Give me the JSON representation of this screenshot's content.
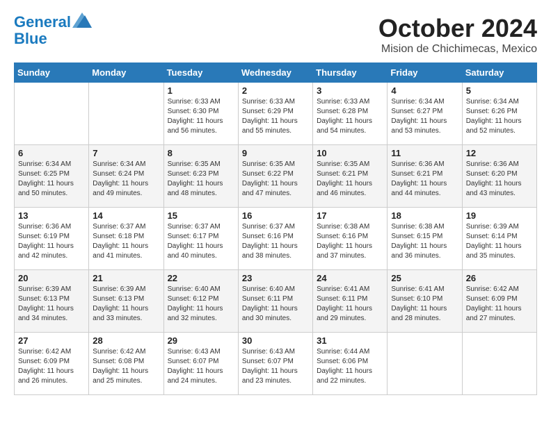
{
  "header": {
    "logo_line1": "General",
    "logo_line2": "Blue",
    "month": "October 2024",
    "location": "Mision de Chichimecas, Mexico"
  },
  "days_of_week": [
    "Sunday",
    "Monday",
    "Tuesday",
    "Wednesday",
    "Thursday",
    "Friday",
    "Saturday"
  ],
  "weeks": [
    [
      {
        "day": "",
        "info": ""
      },
      {
        "day": "",
        "info": ""
      },
      {
        "day": "1",
        "info": "Sunrise: 6:33 AM\nSunset: 6:30 PM\nDaylight: 11 hours and 56 minutes."
      },
      {
        "day": "2",
        "info": "Sunrise: 6:33 AM\nSunset: 6:29 PM\nDaylight: 11 hours and 55 minutes."
      },
      {
        "day": "3",
        "info": "Sunrise: 6:33 AM\nSunset: 6:28 PM\nDaylight: 11 hours and 54 minutes."
      },
      {
        "day": "4",
        "info": "Sunrise: 6:34 AM\nSunset: 6:27 PM\nDaylight: 11 hours and 53 minutes."
      },
      {
        "day": "5",
        "info": "Sunrise: 6:34 AM\nSunset: 6:26 PM\nDaylight: 11 hours and 52 minutes."
      }
    ],
    [
      {
        "day": "6",
        "info": "Sunrise: 6:34 AM\nSunset: 6:25 PM\nDaylight: 11 hours and 50 minutes."
      },
      {
        "day": "7",
        "info": "Sunrise: 6:34 AM\nSunset: 6:24 PM\nDaylight: 11 hours and 49 minutes."
      },
      {
        "day": "8",
        "info": "Sunrise: 6:35 AM\nSunset: 6:23 PM\nDaylight: 11 hours and 48 minutes."
      },
      {
        "day": "9",
        "info": "Sunrise: 6:35 AM\nSunset: 6:22 PM\nDaylight: 11 hours and 47 minutes."
      },
      {
        "day": "10",
        "info": "Sunrise: 6:35 AM\nSunset: 6:21 PM\nDaylight: 11 hours and 46 minutes."
      },
      {
        "day": "11",
        "info": "Sunrise: 6:36 AM\nSunset: 6:21 PM\nDaylight: 11 hours and 44 minutes."
      },
      {
        "day": "12",
        "info": "Sunrise: 6:36 AM\nSunset: 6:20 PM\nDaylight: 11 hours and 43 minutes."
      }
    ],
    [
      {
        "day": "13",
        "info": "Sunrise: 6:36 AM\nSunset: 6:19 PM\nDaylight: 11 hours and 42 minutes."
      },
      {
        "day": "14",
        "info": "Sunrise: 6:37 AM\nSunset: 6:18 PM\nDaylight: 11 hours and 41 minutes."
      },
      {
        "day": "15",
        "info": "Sunrise: 6:37 AM\nSunset: 6:17 PM\nDaylight: 11 hours and 40 minutes."
      },
      {
        "day": "16",
        "info": "Sunrise: 6:37 AM\nSunset: 6:16 PM\nDaylight: 11 hours and 38 minutes."
      },
      {
        "day": "17",
        "info": "Sunrise: 6:38 AM\nSunset: 6:16 PM\nDaylight: 11 hours and 37 minutes."
      },
      {
        "day": "18",
        "info": "Sunrise: 6:38 AM\nSunset: 6:15 PM\nDaylight: 11 hours and 36 minutes."
      },
      {
        "day": "19",
        "info": "Sunrise: 6:39 AM\nSunset: 6:14 PM\nDaylight: 11 hours and 35 minutes."
      }
    ],
    [
      {
        "day": "20",
        "info": "Sunrise: 6:39 AM\nSunset: 6:13 PM\nDaylight: 11 hours and 34 minutes."
      },
      {
        "day": "21",
        "info": "Sunrise: 6:39 AM\nSunset: 6:13 PM\nDaylight: 11 hours and 33 minutes."
      },
      {
        "day": "22",
        "info": "Sunrise: 6:40 AM\nSunset: 6:12 PM\nDaylight: 11 hours and 32 minutes."
      },
      {
        "day": "23",
        "info": "Sunrise: 6:40 AM\nSunset: 6:11 PM\nDaylight: 11 hours and 30 minutes."
      },
      {
        "day": "24",
        "info": "Sunrise: 6:41 AM\nSunset: 6:11 PM\nDaylight: 11 hours and 29 minutes."
      },
      {
        "day": "25",
        "info": "Sunrise: 6:41 AM\nSunset: 6:10 PM\nDaylight: 11 hours and 28 minutes."
      },
      {
        "day": "26",
        "info": "Sunrise: 6:42 AM\nSunset: 6:09 PM\nDaylight: 11 hours and 27 minutes."
      }
    ],
    [
      {
        "day": "27",
        "info": "Sunrise: 6:42 AM\nSunset: 6:09 PM\nDaylight: 11 hours and 26 minutes."
      },
      {
        "day": "28",
        "info": "Sunrise: 6:42 AM\nSunset: 6:08 PM\nDaylight: 11 hours and 25 minutes."
      },
      {
        "day": "29",
        "info": "Sunrise: 6:43 AM\nSunset: 6:07 PM\nDaylight: 11 hours and 24 minutes."
      },
      {
        "day": "30",
        "info": "Sunrise: 6:43 AM\nSunset: 6:07 PM\nDaylight: 11 hours and 23 minutes."
      },
      {
        "day": "31",
        "info": "Sunrise: 6:44 AM\nSunset: 6:06 PM\nDaylight: 11 hours and 22 minutes."
      },
      {
        "day": "",
        "info": ""
      },
      {
        "day": "",
        "info": ""
      }
    ]
  ]
}
